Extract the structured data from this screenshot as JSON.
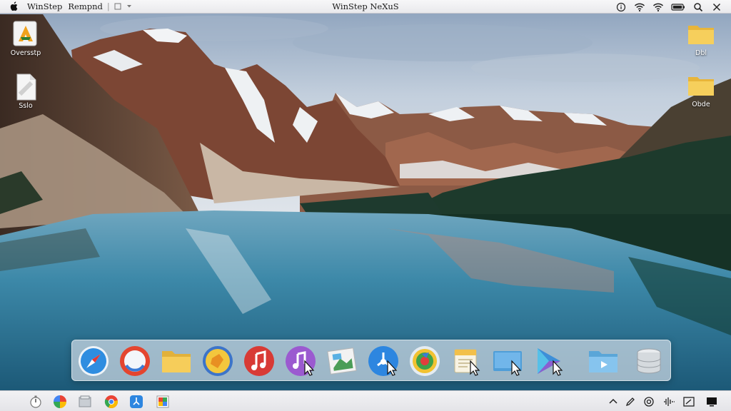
{
  "menubar": {
    "app_name": "WinStep",
    "menu_item": "Rempnd",
    "window_title": "WinStep NeXuS",
    "status_icons": [
      "info-icon",
      "wifi-icon",
      "wifi-icon",
      "battery-icon",
      "search-icon",
      "close-icon"
    ]
  },
  "desktop": {
    "wallpaper": "mountain-lake",
    "left_icons": [
      {
        "label": "Oversstp",
        "icon": "triangle-app-icon"
      },
      {
        "label": "Sslo",
        "icon": "document-icon"
      }
    ],
    "right_icons": [
      {
        "label": "Dbl",
        "icon": "folder-icon"
      },
      {
        "label": "Obde",
        "icon": "folder-icon"
      }
    ]
  },
  "dock": {
    "items": [
      "safari-icon",
      "browser-icon",
      "folder-icon",
      "sketch-app-icon",
      "music-icon",
      "itunes-icon",
      "image-editor-icon",
      "app-store-icon",
      "gear-globe-icon",
      "notes-icon",
      "screen-icon",
      "play-icon",
      "media-folder-icon",
      "disk-stack-icon"
    ]
  },
  "taskbar": {
    "start_items": [
      "timer-icon",
      "pinwheel-icon",
      "files-icon",
      "chrome-icon",
      "app-store-icon",
      "photos-icon"
    ],
    "tray_items": [
      "chevron-up-icon",
      "pen-icon",
      "refresh-icon",
      "audio-wave-icon",
      "screenshot-icon",
      "display-icon"
    ]
  },
  "colors": {
    "sky": "#b8c6d8",
    "lake": "#2f7a9c",
    "forest": "#1e3a2e",
    "rock": "#8a4c3a",
    "dock_bg": "#cedae4",
    "folder": "#f2c94c"
  }
}
